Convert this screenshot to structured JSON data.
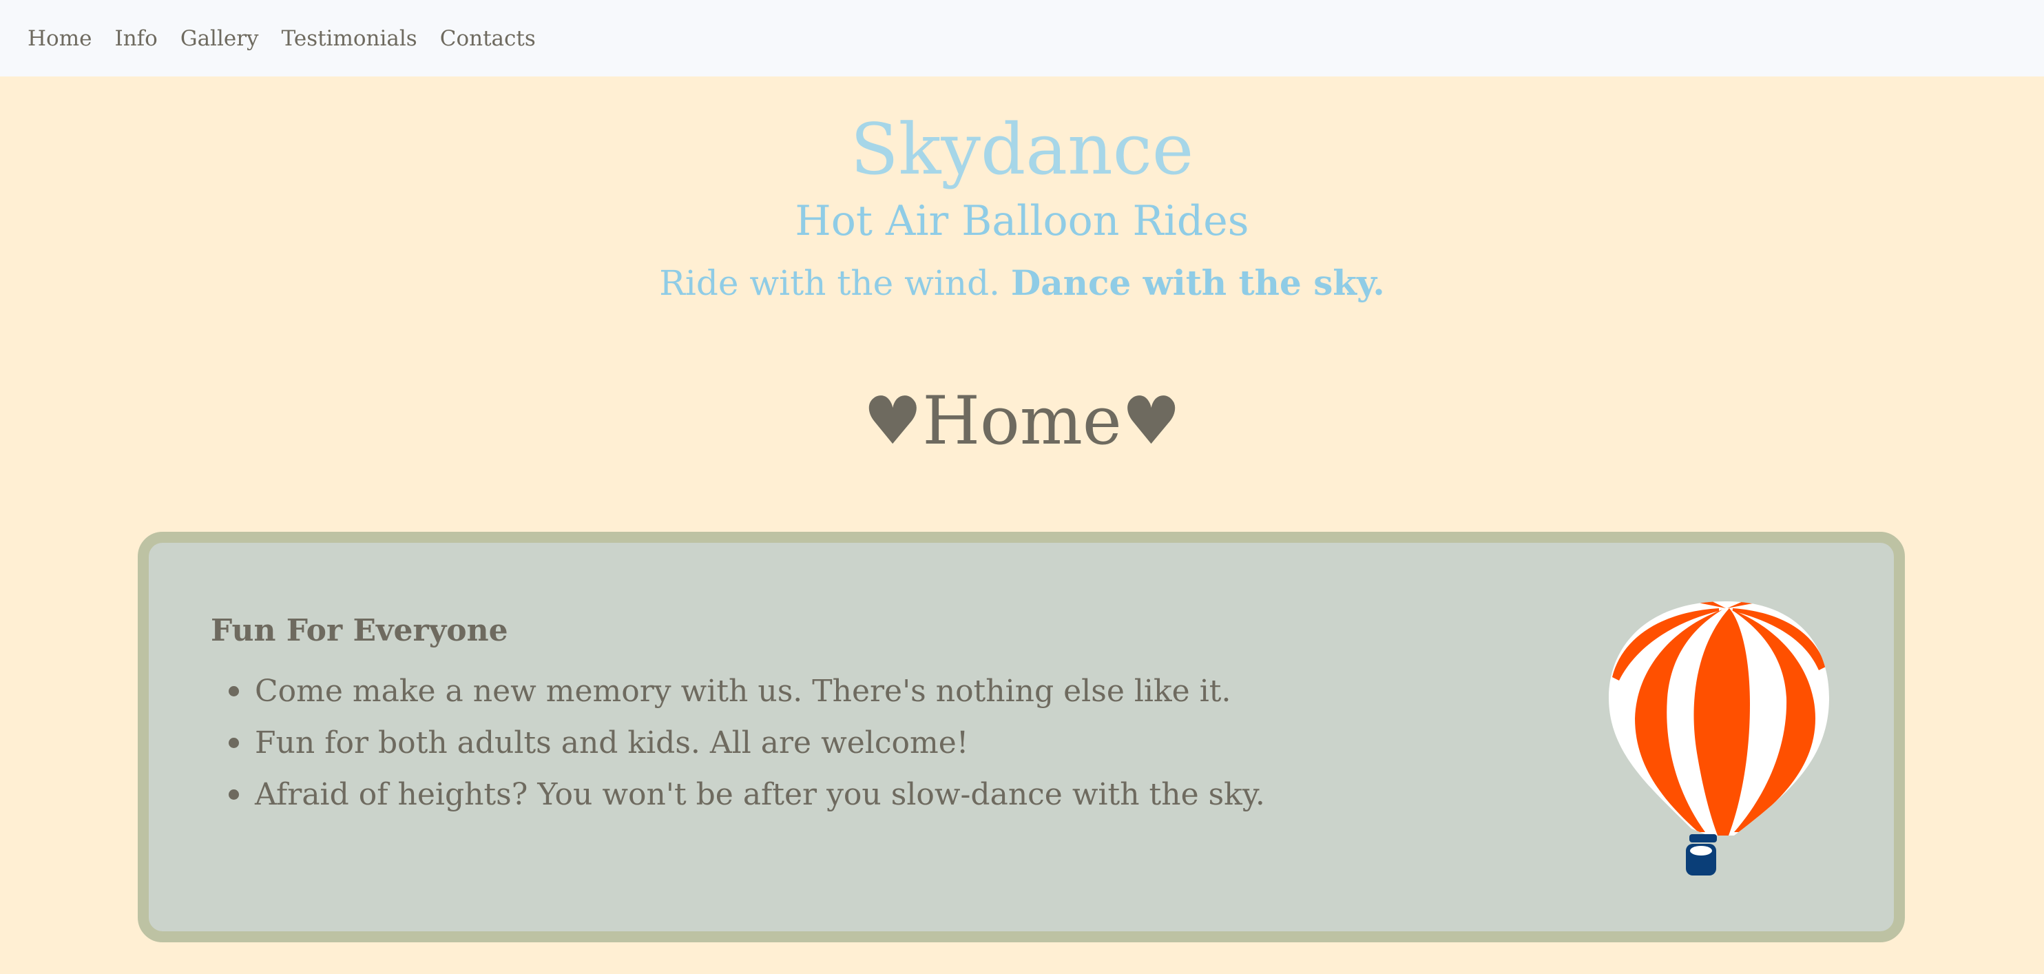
{
  "nav": {
    "items": [
      "Home",
      "Info",
      "Gallery",
      "Testimonials",
      "Contacts"
    ]
  },
  "hero": {
    "title": "Skydance",
    "subtitle": "Hot Air Balloon Rides",
    "tagline_plain": "Ride with the wind.",
    "tagline_bold": "Dance with the sky."
  },
  "section": {
    "title": "♥Home♥"
  },
  "card": {
    "heading": "Fun For Everyone",
    "items": [
      "Come make a new memory with us. There's nothing else like it.",
      "Fun for both adults and kids. All are welcome!",
      "Afraid of heights? You won't be after you slow-dance with the sky."
    ],
    "image_icon": "hot-air-balloon-icon"
  },
  "colors": {
    "page_background": "#FFEFD3",
    "nav_background": "#F7F9FC",
    "title_blue": "#A6D6E8",
    "text_gray": "#6E6A5F",
    "card_background": "#CBD3CB",
    "card_border": "#BDC2A3",
    "balloon_orange": "#FF5000",
    "basket_blue": "#0A3E78"
  }
}
